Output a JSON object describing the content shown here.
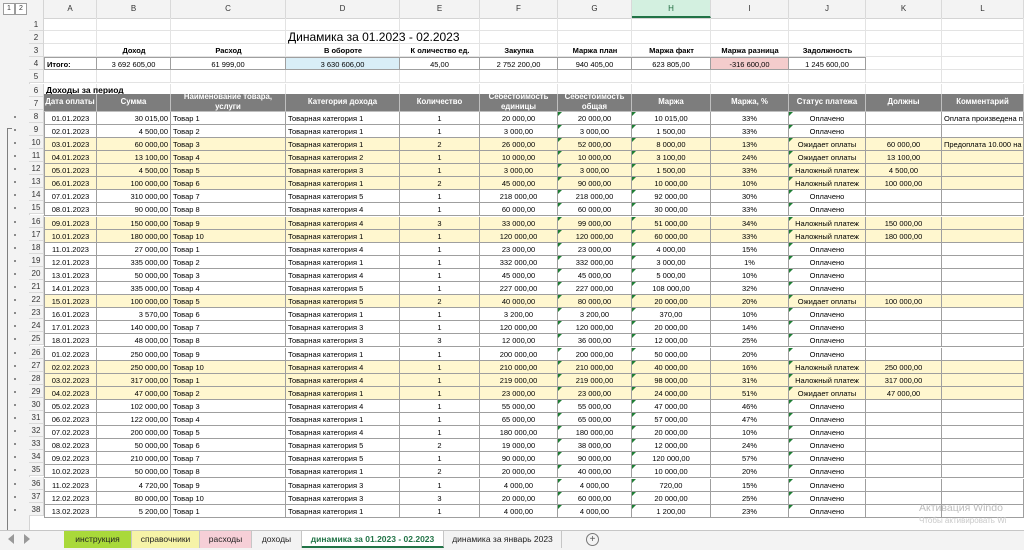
{
  "outline_levels": [
    "1",
    "2"
  ],
  "columns": [
    "A",
    "B",
    "C",
    "D",
    "E",
    "F",
    "G",
    "H",
    "I",
    "J",
    "K",
    "L"
  ],
  "selected_column": "H",
  "title": "Динамика за 01.2023 - 02.2023",
  "summary": {
    "labels": [
      "Доход",
      "Расход",
      "В обороте",
      "К оличество ед.",
      "Закупка",
      "Маржа план",
      "Маржа факт",
      "Маржа разница",
      "Задолжность"
    ],
    "total_label": "Итого:",
    "values": [
      "3 692 605,00",
      "61 999,00",
      "3 630 606,00",
      "45,00",
      "2 752 200,00",
      "940 405,00",
      "623 805,00",
      "-316 600,00",
      "1 245 600,00"
    ],
    "colors": {
      "in_turnover": "#d9eef7",
      "margin_diff": "#f4cccc"
    }
  },
  "section_label": "Доходы за период",
  "table_headers": [
    "Дата оплаты",
    "Сумма",
    "Наименование товара, услуги",
    "Категория дохода",
    "Количество",
    "Себестоимость единицы",
    "Себестоимость общая",
    "Маржа",
    "Маржа, %",
    "Статус платежа",
    "Должны",
    "Комментарий"
  ],
  "row_numbers": [
    "1",
    "2",
    "3",
    "4",
    "5",
    "6",
    "7",
    "8",
    "9",
    "10",
    "11",
    "12",
    "13",
    "14",
    "15",
    "16",
    "17",
    "18",
    "19",
    "20",
    "21",
    "22",
    "23",
    "24",
    "25",
    "26",
    "27",
    "28",
    "29",
    "30",
    "31",
    "32",
    "33",
    "34",
    "35",
    "36",
    "37",
    "38"
  ],
  "rows": [
    {
      "d": "01.01.2023",
      "s": "30 015,00",
      "n": "Товар 1",
      "k": "Товарная категория 1",
      "q": "1",
      "cu": "20 000,00",
      "ct": "20 000,00",
      "m": "10 015,00",
      "mp": "33%",
      "st": "Оплачено",
      "dol": "",
      "com": "Оплата произведена по",
      "y": false
    },
    {
      "d": "02.01.2023",
      "s": "4 500,00",
      "n": "Товар 2",
      "k": "Товарная категория 1",
      "q": "1",
      "cu": "3 000,00",
      "ct": "3 000,00",
      "m": "1 500,00",
      "mp": "33%",
      "st": "Оплачено",
      "dol": "",
      "com": "",
      "y": false
    },
    {
      "d": "03.01.2023",
      "s": "60 000,00",
      "n": "Товар 3",
      "k": "Товарная категория 1",
      "q": "2",
      "cu": "26 000,00",
      "ct": "52 000,00",
      "m": "8 000,00",
      "mp": "13%",
      "st": "Ожидает оплаты",
      "dol": "60 000,00",
      "com": "Предоплата 10.000 на к",
      "y": true
    },
    {
      "d": "04.01.2023",
      "s": "13 100,00",
      "n": "Товар 4",
      "k": "Товарная категория 2",
      "q": "1",
      "cu": "10 000,00",
      "ct": "10 000,00",
      "m": "3 100,00",
      "mp": "24%",
      "st": "Ожидает оплаты",
      "dol": "13 100,00",
      "com": "",
      "y": true
    },
    {
      "d": "05.01.2023",
      "s": "4 500,00",
      "n": "Товар 5",
      "k": "Товарная категория 3",
      "q": "1",
      "cu": "3 000,00",
      "ct": "3 000,00",
      "m": "1 500,00",
      "mp": "33%",
      "st": "Наложный платеж",
      "dol": "4 500,00",
      "com": "",
      "y": true
    },
    {
      "d": "06.01.2023",
      "s": "100 000,00",
      "n": "Товар 6",
      "k": "Товарная категория 1",
      "q": "2",
      "cu": "45 000,00",
      "ct": "90 000,00",
      "m": "10 000,00",
      "mp": "10%",
      "st": "Наложный платеж",
      "dol": "100 000,00",
      "com": "",
      "y": true
    },
    {
      "d": "07.01.2023",
      "s": "310 000,00",
      "n": "Товар 7",
      "k": "Товарная категория 5",
      "q": "1",
      "cu": "218 000,00",
      "ct": "218 000,00",
      "m": "92 000,00",
      "mp": "30%",
      "st": "Оплачено",
      "dol": "",
      "com": "",
      "y": false
    },
    {
      "d": "08.01.2023",
      "s": "90 000,00",
      "n": "Товар 8",
      "k": "Товарная категория 4",
      "q": "1",
      "cu": "60 000,00",
      "ct": "60 000,00",
      "m": "30 000,00",
      "mp": "33%",
      "st": "Оплачено",
      "dol": "",
      "com": "",
      "y": false
    },
    {
      "d": "09.01.2023",
      "s": "150 000,00",
      "n": "Товар 9",
      "k": "Товарная категория 4",
      "q": "3",
      "cu": "33 000,00",
      "ct": "99 000,00",
      "m": "51 000,00",
      "mp": "34%",
      "st": "Наложный платеж",
      "dol": "150 000,00",
      "com": "",
      "y": true
    },
    {
      "d": "10.01.2023",
      "s": "180 000,00",
      "n": "Товар 10",
      "k": "Товарная категория 1",
      "q": "1",
      "cu": "120 000,00",
      "ct": "120 000,00",
      "m": "60 000,00",
      "mp": "33%",
      "st": "Наложный платеж",
      "dol": "180 000,00",
      "com": "",
      "y": true
    },
    {
      "d": "11.01.2023",
      "s": "27 000,00",
      "n": "Товар 1",
      "k": "Товарная категория 4",
      "q": "1",
      "cu": "23 000,00",
      "ct": "23 000,00",
      "m": "4 000,00",
      "mp": "15%",
      "st": "Оплачено",
      "dol": "",
      "com": "",
      "y": false
    },
    {
      "d": "12.01.2023",
      "s": "335 000,00",
      "n": "Товар 2",
      "k": "Товарная категория 1",
      "q": "1",
      "cu": "332 000,00",
      "ct": "332 000,00",
      "m": "3 000,00",
      "mp": "1%",
      "st": "Оплачено",
      "dol": "",
      "com": "",
      "y": false
    },
    {
      "d": "13.01.2023",
      "s": "50 000,00",
      "n": "Товар 3",
      "k": "Товарная категория 4",
      "q": "1",
      "cu": "45 000,00",
      "ct": "45 000,00",
      "m": "5 000,00",
      "mp": "10%",
      "st": "Оплачено",
      "dol": "",
      "com": "",
      "y": false
    },
    {
      "d": "14.01.2023",
      "s": "335 000,00",
      "n": "Товар 4",
      "k": "Товарная категория 5",
      "q": "1",
      "cu": "227 000,00",
      "ct": "227 000,00",
      "m": "108 000,00",
      "mp": "32%",
      "st": "Оплачено",
      "dol": "",
      "com": "",
      "y": false
    },
    {
      "d": "15.01.2023",
      "s": "100 000,00",
      "n": "Товар 5",
      "k": "Товарная категория 5",
      "q": "2",
      "cu": "40 000,00",
      "ct": "80 000,00",
      "m": "20 000,00",
      "mp": "20%",
      "st": "Ожидает оплаты",
      "dol": "100 000,00",
      "com": "",
      "y": true
    },
    {
      "d": "16.01.2023",
      "s": "3 570,00",
      "n": "Товар 6",
      "k": "Товарная категория 1",
      "q": "1",
      "cu": "3 200,00",
      "ct": "3 200,00",
      "m": "370,00",
      "mp": "10%",
      "st": "Оплачено",
      "dol": "",
      "com": "",
      "y": false
    },
    {
      "d": "17.01.2023",
      "s": "140 000,00",
      "n": "Товар 7",
      "k": "Товарная категория 3",
      "q": "1",
      "cu": "120 000,00",
      "ct": "120 000,00",
      "m": "20 000,00",
      "mp": "14%",
      "st": "Оплачено",
      "dol": "",
      "com": "",
      "y": false
    },
    {
      "d": "18.01.2023",
      "s": "48 000,00",
      "n": "Товар 8",
      "k": "Товарная категория 3",
      "q": "3",
      "cu": "12 000,00",
      "ct": "36 000,00",
      "m": "12 000,00",
      "mp": "25%",
      "st": "Оплачено",
      "dol": "",
      "com": "",
      "y": false
    },
    {
      "d": "01.02.2023",
      "s": "250 000,00",
      "n": "Товар 9",
      "k": "Товарная категория 1",
      "q": "1",
      "cu": "200 000,00",
      "ct": "200 000,00",
      "m": "50 000,00",
      "mp": "20%",
      "st": "Оплачено",
      "dol": "",
      "com": "",
      "y": false
    },
    {
      "d": "02.02.2023",
      "s": "250 000,00",
      "n": "Товар 10",
      "k": "Товарная категория 4",
      "q": "1",
      "cu": "210 000,00",
      "ct": "210 000,00",
      "m": "40 000,00",
      "mp": "16%",
      "st": "Наложный платеж",
      "dol": "250 000,00",
      "com": "",
      "y": true
    },
    {
      "d": "03.02.2023",
      "s": "317 000,00",
      "n": "Товар 1",
      "k": "Товарная категория 4",
      "q": "1",
      "cu": "219 000,00",
      "ct": "219 000,00",
      "m": "98 000,00",
      "mp": "31%",
      "st": "Наложный платеж",
      "dol": "317 000,00",
      "com": "",
      "y": true
    },
    {
      "d": "04.02.2023",
      "s": "47 000,00",
      "n": "Товар 2",
      "k": "Товарная категория 1",
      "q": "1",
      "cu": "23 000,00",
      "ct": "23 000,00",
      "m": "24 000,00",
      "mp": "51%",
      "st": "Ожидает оплаты",
      "dol": "47 000,00",
      "com": "",
      "y": true
    },
    {
      "d": "05.02.2023",
      "s": "102 000,00",
      "n": "Товар 3",
      "k": "Товарная категория 4",
      "q": "1",
      "cu": "55 000,00",
      "ct": "55 000,00",
      "m": "47 000,00",
      "mp": "46%",
      "st": "Оплачено",
      "dol": "",
      "com": "",
      "y": false
    },
    {
      "d": "06.02.2023",
      "s": "122 000,00",
      "n": "Товар 4",
      "k": "Товарная категория 1",
      "q": "1",
      "cu": "65 000,00",
      "ct": "65 000,00",
      "m": "57 000,00",
      "mp": "47%",
      "st": "Оплачено",
      "dol": "",
      "com": "",
      "y": false
    },
    {
      "d": "07.02.2023",
      "s": "200 000,00",
      "n": "Товар 5",
      "k": "Товарная категория 4",
      "q": "1",
      "cu": "180 000,00",
      "ct": "180 000,00",
      "m": "20 000,00",
      "mp": "10%",
      "st": "Оплачено",
      "dol": "",
      "com": "",
      "y": false
    },
    {
      "d": "08.02.2023",
      "s": "50 000,00",
      "n": "Товар 6",
      "k": "Товарная категория 5",
      "q": "2",
      "cu": "19 000,00",
      "ct": "38 000,00",
      "m": "12 000,00",
      "mp": "24%",
      "st": "Оплачено",
      "dol": "",
      "com": "",
      "y": false
    },
    {
      "d": "09.02.2023",
      "s": "210 000,00",
      "n": "Товар 7",
      "k": "Товарная категория 5",
      "q": "1",
      "cu": "90 000,00",
      "ct": "90 000,00",
      "m": "120 000,00",
      "mp": "57%",
      "st": "Оплачено",
      "dol": "",
      "com": "",
      "y": false
    },
    {
      "d": "10.02.2023",
      "s": "50 000,00",
      "n": "Товар 8",
      "k": "Товарная категория 1",
      "q": "2",
      "cu": "20 000,00",
      "ct": "40 000,00",
      "m": "10 000,00",
      "mp": "20%",
      "st": "Оплачено",
      "dol": "",
      "com": "",
      "y": false
    },
    {
      "d": "11.02.2023",
      "s": "4 720,00",
      "n": "Товар 9",
      "k": "Товарная категория 3",
      "q": "1",
      "cu": "4 000,00",
      "ct": "4 000,00",
      "m": "720,00",
      "mp": "15%",
      "st": "Оплачено",
      "dol": "",
      "com": "",
      "y": false
    },
    {
      "d": "12.02.2023",
      "s": "80 000,00",
      "n": "Товар 10",
      "k": "Товарная категория 3",
      "q": "3",
      "cu": "20 000,00",
      "ct": "60 000,00",
      "m": "20 000,00",
      "mp": "25%",
      "st": "Оплачено",
      "dol": "",
      "com": "",
      "y": false
    },
    {
      "d": "13.02.2023",
      "s": "5 200,00",
      "n": "Товар 1",
      "k": "Товарная категория 1",
      "q": "1",
      "cu": "4 000,00",
      "ct": "4 000,00",
      "m": "1 200,00",
      "mp": "23%",
      "st": "Оплачено",
      "dol": "",
      "com": "",
      "y": false
    }
  ],
  "sheet_tabs": [
    {
      "label": "инструкция",
      "color": "#a9d93a"
    },
    {
      "label": "справочники",
      "color": "#f6f3a7"
    },
    {
      "label": "расходы",
      "color": "#f6cfd7"
    },
    {
      "label": "доходы",
      "color": ""
    },
    {
      "label": "динамика за 01.2023 - 02.2023",
      "color": "",
      "active": true
    },
    {
      "label": "динамика за январь 2023",
      "color": ""
    }
  ],
  "add_sheet_icon": "plus-circle-icon",
  "watermark": {
    "line1": "Активация Windo",
    "line2": "Чтобы активировать Wi"
  }
}
